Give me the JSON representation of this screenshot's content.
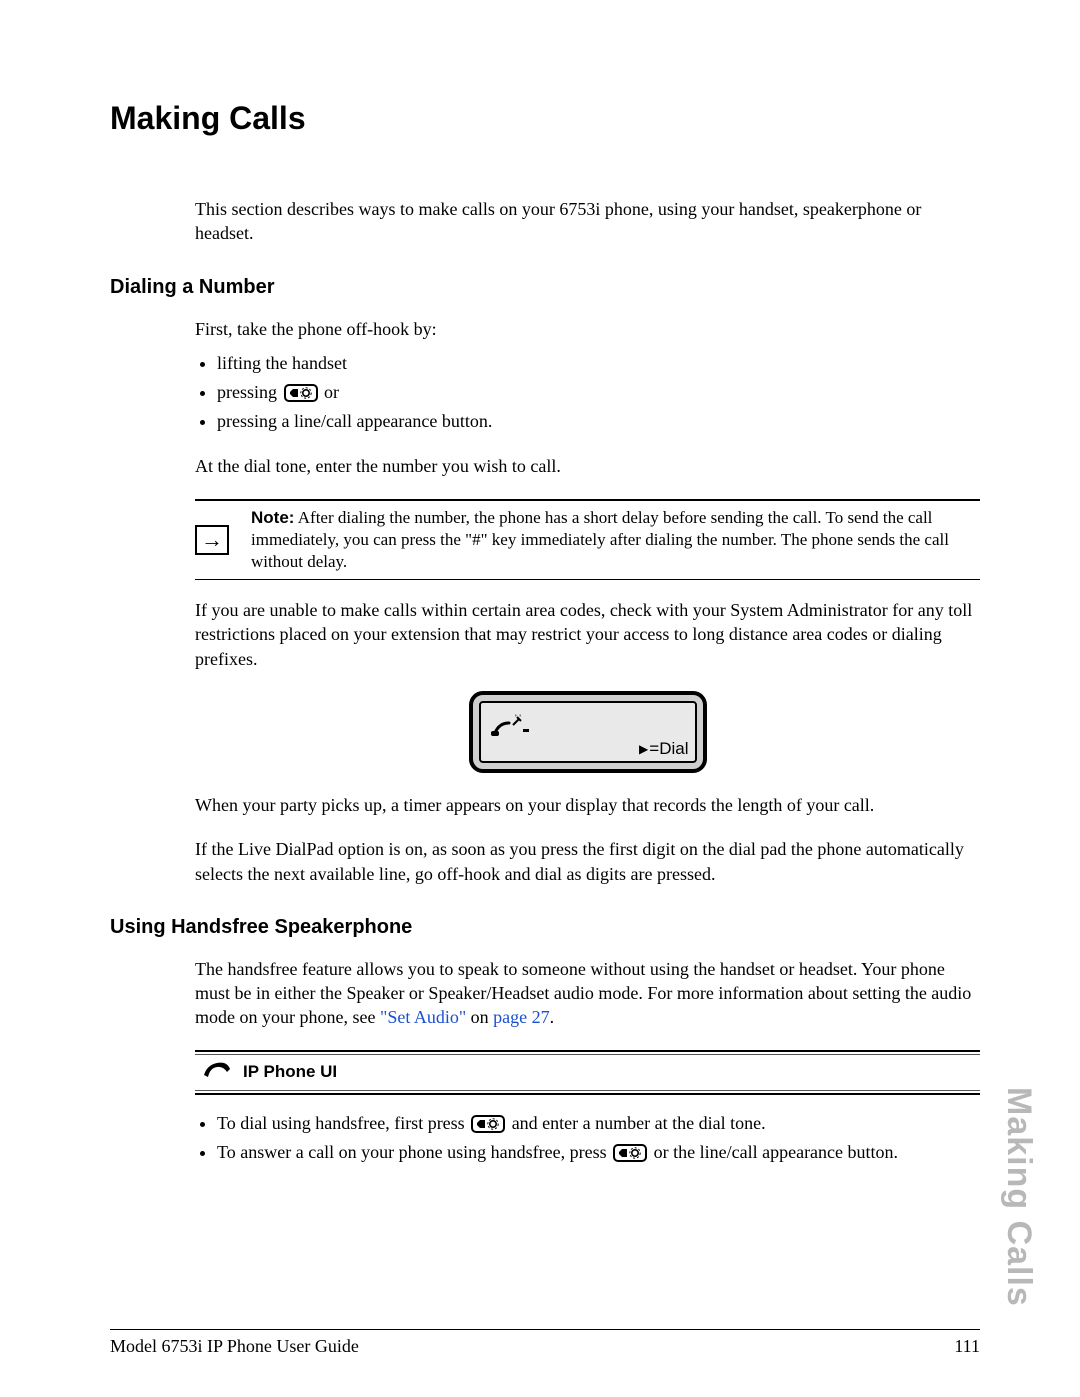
{
  "title": "Making Calls",
  "intro": "This section describes ways to make calls on your 6753i phone, using your handset, speakerphone or headset.",
  "section_dialing": {
    "heading": "Dialing a Number",
    "lead": "First, take the phone off-hook by:",
    "bullets": {
      "b1": "lifting the handset",
      "b2_pre": "pressing ",
      "b2_post": " or",
      "b3": "pressing a line/call appearance button."
    },
    "after_bullets": "At the dial tone, enter the number you wish to call.",
    "note_label": "Note:",
    "note_body": " After dialing the number, the phone has a short delay before sending the call. To send the call immediately, you can press the \"#\" key immediately after dialing the number. The phone sends the call without delay.",
    "para_restrict": "If you are unable to make calls within certain area codes, check with your System Administrator for any toll restrictions placed on your extension that may restrict your access to long distance area codes or dialing prefixes.",
    "lcd_text": "=Dial",
    "para_timer": "When your party picks up, a timer appears on your display that records the length of your call.",
    "para_livedialpad": "If the Live DialPad option is on, as soon as you press the first digit on the dial pad the phone automatically selects the next available line, go off-hook and dial as digits are pressed."
  },
  "section_handsfree": {
    "heading": "Using Handsfree Speakerphone",
    "para_pre": "The handsfree feature allows you to speak to someone without using the handset or headset. Your phone must be in either the Speaker or Speaker/Headset audio mode. For more information about setting the audio mode on your phone, see ",
    "link_setaudio": "\"Set Audio\"",
    "para_mid": " on ",
    "link_page": "page 27",
    "para_post": ".",
    "ui_label": "IP Phone UI",
    "bullets": {
      "b1_pre": "To dial using handsfree, first press ",
      "b1_post": " and enter a number at the dial tone.",
      "b2_pre": "To answer a call on your phone using handsfree, press ",
      "b2_post": " or the line/call appearance button."
    }
  },
  "side_tab": "Making Calls",
  "footer": {
    "left": "Model 6753i IP Phone User Guide",
    "right": "111"
  }
}
